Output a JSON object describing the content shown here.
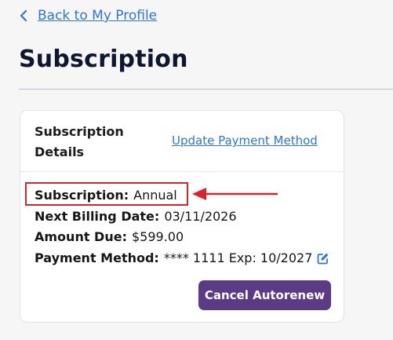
{
  "nav": {
    "back_label": "Back to My Profile"
  },
  "page": {
    "title": "Subscription"
  },
  "card": {
    "title": "Subscription Details",
    "update_link": "Update Payment Method",
    "rows": [
      {
        "label": "Subscription:",
        "value": "Annual"
      },
      {
        "label": "Next Billing Date:",
        "value": "03/11/2026"
      },
      {
        "label": "Amount Due:",
        "value": "$599.00"
      },
      {
        "label": "Payment Method:",
        "value": "**** 1111 Exp: 10/2027"
      }
    ],
    "cancel_button": "Cancel Autorenew"
  },
  "colors": {
    "link": "#2d77d6",
    "title": "#0f1630",
    "button": "#5b3b85",
    "annotation": "#d7232a"
  },
  "icons": {
    "back": "chevron-left-icon",
    "edit": "edit-icon",
    "annotation_arrow": "arrow-left-icon"
  }
}
